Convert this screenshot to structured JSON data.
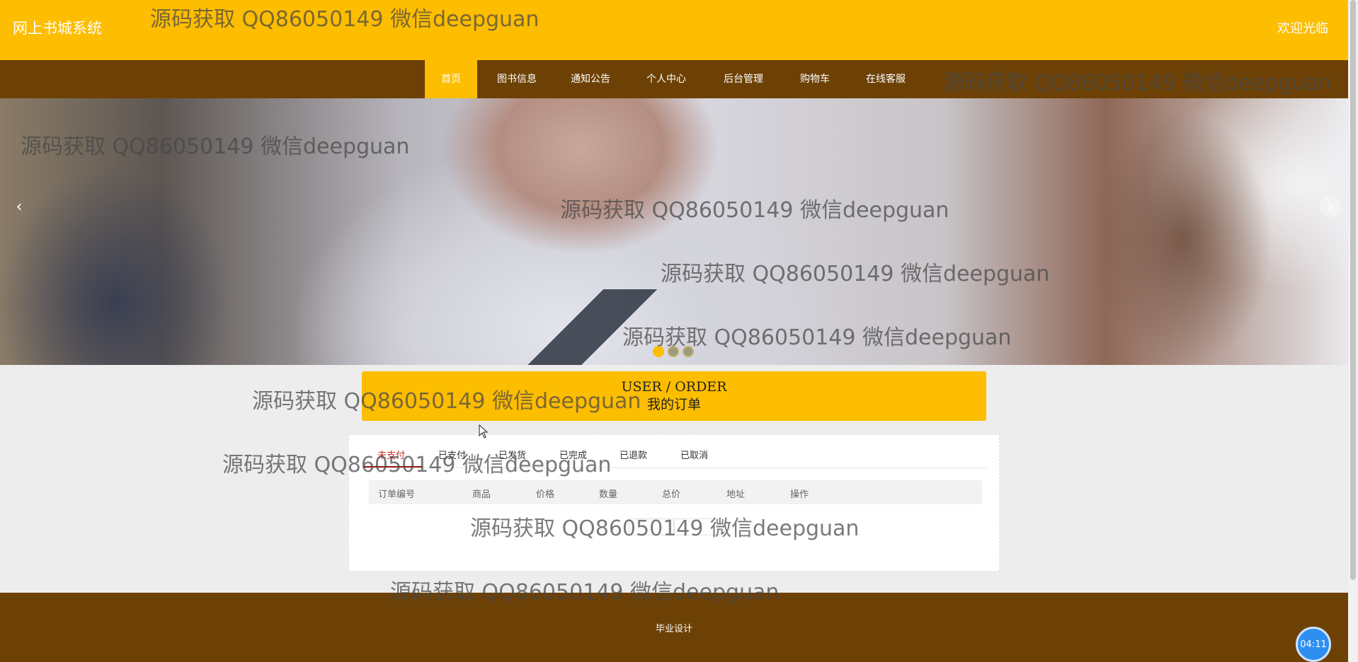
{
  "header": {
    "site_title": "网上书城系统",
    "welcome": "欢迎光临"
  },
  "nav": {
    "items": [
      {
        "label": "首页",
        "active": true
      },
      {
        "label": "图书信息"
      },
      {
        "label": "通知公告"
      },
      {
        "label": "个人中心"
      },
      {
        "label": "后台管理"
      },
      {
        "label": "购物车"
      },
      {
        "label": "在线客服"
      }
    ]
  },
  "carousel": {
    "slide_count": 3,
    "active_index": 0
  },
  "order": {
    "title_en": "USER / ORDER",
    "title_cn": "我的订单",
    "tabs": [
      {
        "label": "未支付",
        "active": true
      },
      {
        "label": "已支付"
      },
      {
        "label": "已发货"
      },
      {
        "label": "已完成"
      },
      {
        "label": "已退款"
      },
      {
        "label": "已取消"
      }
    ],
    "columns": [
      "订单编号",
      "商品",
      "价格",
      "数量",
      "总价",
      "地址",
      "操作"
    ]
  },
  "footer": {
    "text": "毕业设计"
  },
  "timer": "04:11",
  "watermark": "源码获取 QQ86050149 微信deepguan",
  "colors": {
    "accent": "#fdbd00",
    "brown": "#6d4105",
    "active_tab": "#c7302a"
  }
}
